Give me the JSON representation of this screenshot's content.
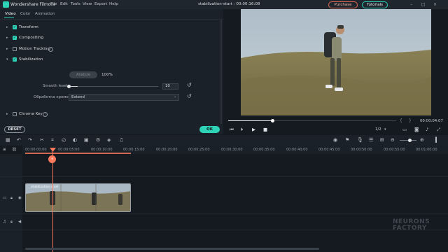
{
  "app": {
    "name": "Wondershare Filmora",
    "menu": [
      "File",
      "Edit",
      "Tools",
      "View",
      "Export",
      "Help"
    ],
    "document_title": "stabilization-start : 00:00:16:08",
    "purchase_label": "Purchase",
    "tutorials_label": "Tutorials"
  },
  "panel": {
    "tabs": [
      "Video",
      "Color",
      "Animation"
    ],
    "sections": [
      {
        "label": "Transform",
        "checked": true
      },
      {
        "label": "Compositing",
        "checked": true
      },
      {
        "label": "Motion Tracking",
        "checked": false
      },
      {
        "label": "Stabilization",
        "checked": true
      }
    ],
    "analyze_label": "Analyze",
    "analyze_progress": "100%",
    "smooth_label": "Smooth level",
    "smooth_value": "10",
    "border_label": "Обработка кромок:",
    "border_value": "Extend",
    "chroma_label": "Chroma Key",
    "reset_label": "RESET",
    "ok_label": "OK"
  },
  "preview": {
    "timecode": "00:00:04:07",
    "ratio": "1/2",
    "progress": 0.26
  },
  "timeline": {
    "ticks": [
      "00:00:00:00",
      "00:00:05:00",
      "00:00:10:00",
      "00:00:15:00",
      "00:00:20:00",
      "00:00:25:00",
      "00:00:30:00",
      "00:00:35:00",
      "00:00:40:00",
      "00:00:45:00",
      "00:00:50:00",
      "00:00:55:00",
      "00:01:00:00"
    ],
    "clip_label": "stabilization-start",
    "watermark_line1": "NEURONS",
    "watermark_line2": "FACTORY"
  },
  "colors": {
    "accent": "#2ed3b7",
    "playhead": "#ff7a5c",
    "purchase": "#e5674f"
  }
}
